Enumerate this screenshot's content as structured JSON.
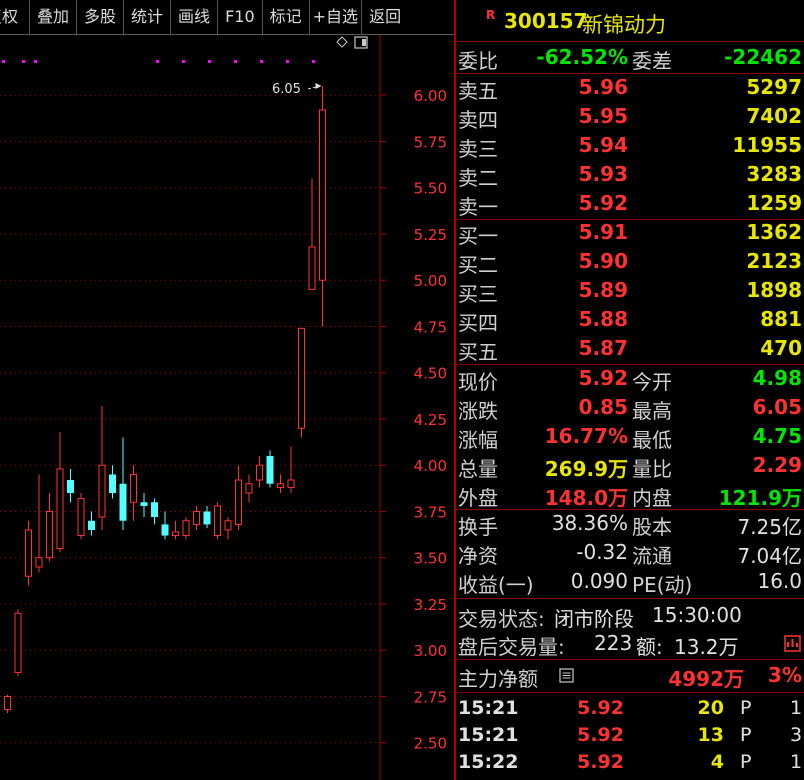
{
  "toolbar": [
    "复权",
    "叠加",
    "多股",
    "统计",
    "画线",
    "F10",
    "标记",
    "+自选",
    "返回"
  ],
  "chart_data": {
    "type": "candlestick",
    "ylim": [
      2.45,
      6.12
    ],
    "y_ticks": [
      "6.00",
      "5.75",
      "5.50",
      "5.25",
      "5.00",
      "4.75",
      "4.50",
      "4.25",
      "4.00",
      "3.75",
      "3.50",
      "3.25",
      "3.00",
      "2.75",
      "2.50"
    ],
    "high_annotation": "6.05",
    "candles": [
      {
        "o": 2.68,
        "c": 2.75,
        "h": 2.76,
        "l": 2.66
      },
      {
        "o": 2.88,
        "c": 3.2,
        "h": 3.22,
        "l": 2.86
      },
      {
        "o": 3.4,
        "c": 3.65,
        "h": 3.7,
        "l": 3.35
      },
      {
        "o": 3.45,
        "c": 3.5,
        "h": 3.95,
        "l": 3.42
      },
      {
        "o": 3.5,
        "c": 3.75,
        "h": 3.85,
        "l": 3.48
      },
      {
        "o": 3.55,
        "c": 3.98,
        "h": 4.18,
        "l": 3.53
      },
      {
        "o": 3.92,
        "c": 3.85,
        "h": 3.98,
        "l": 3.8
      },
      {
        "o": 3.62,
        "c": 3.82,
        "h": 3.85,
        "l": 3.6
      },
      {
        "o": 3.7,
        "c": 3.65,
        "h": 3.75,
        "l": 3.62
      },
      {
        "o": 3.72,
        "c": 4.0,
        "h": 4.32,
        "l": 3.65
      },
      {
        "o": 3.95,
        "c": 3.85,
        "h": 4.0,
        "l": 3.82
      },
      {
        "o": 3.9,
        "c": 3.7,
        "h": 4.15,
        "l": 3.65
      },
      {
        "o": 3.8,
        "c": 3.95,
        "h": 4.0,
        "l": 3.7
      },
      {
        "o": 3.8,
        "c": 3.78,
        "h": 3.85,
        "l": 3.72
      },
      {
        "o": 3.8,
        "c": 3.72,
        "h": 3.82,
        "l": 3.68
      },
      {
        "o": 3.68,
        "c": 3.62,
        "h": 3.75,
        "l": 3.6
      },
      {
        "o": 3.62,
        "c": 3.64,
        "h": 3.7,
        "l": 3.6
      },
      {
        "o": 3.62,
        "c": 3.7,
        "h": 3.72,
        "l": 3.6
      },
      {
        "o": 3.68,
        "c": 3.75,
        "h": 3.78,
        "l": 3.65
      },
      {
        "o": 3.75,
        "c": 3.68,
        "h": 3.78,
        "l": 3.66
      },
      {
        "o": 3.62,
        "c": 3.78,
        "h": 3.8,
        "l": 3.6
      },
      {
        "o": 3.65,
        "c": 3.7,
        "h": 3.72,
        "l": 3.6
      },
      {
        "o": 3.68,
        "c": 3.92,
        "h": 4.0,
        "l": 3.65
      },
      {
        "o": 3.85,
        "c": 3.9,
        "h": 3.95,
        "l": 3.8
      },
      {
        "o": 3.92,
        "c": 4.0,
        "h": 4.05,
        "l": 3.88
      },
      {
        "o": 4.05,
        "c": 3.9,
        "h": 4.08,
        "l": 3.88
      },
      {
        "o": 3.88,
        "c": 3.9,
        "h": 3.95,
        "l": 3.85
      },
      {
        "o": 3.88,
        "c": 3.92,
        "h": 4.1,
        "l": 3.85
      },
      {
        "o": 4.2,
        "c": 4.74,
        "h": 4.74,
        "l": 4.15
      },
      {
        "o": 4.95,
        "c": 5.18,
        "h": 5.55,
        "l": 4.95
      },
      {
        "o": 5.0,
        "c": 5.92,
        "h": 6.05,
        "l": 4.75
      }
    ]
  },
  "quote": {
    "flag": "R",
    "code": "300157",
    "name": "新锦动力",
    "wb_label": "委比",
    "wb": "-62.52%",
    "wc_label": "委差",
    "wc": "-22462",
    "asks": [
      {
        "label": "卖五",
        "price": "5.96",
        "vol": "5297"
      },
      {
        "label": "卖四",
        "price": "5.95",
        "vol": "7402"
      },
      {
        "label": "卖三",
        "price": "5.94",
        "vol": "11955"
      },
      {
        "label": "卖二",
        "price": "5.93",
        "vol": "3283"
      },
      {
        "label": "卖一",
        "price": "5.92",
        "vol": "1259"
      }
    ],
    "bids": [
      {
        "label": "买一",
        "price": "5.91",
        "vol": "1362"
      },
      {
        "label": "买二",
        "price": "5.90",
        "vol": "2123"
      },
      {
        "label": "买三",
        "price": "5.89",
        "vol": "1898"
      },
      {
        "label": "买四",
        "price": "5.88",
        "vol": "881"
      },
      {
        "label": "买五",
        "price": "5.87",
        "vol": "470"
      }
    ],
    "stats": [
      {
        "l1": "现价",
        "v1": "5.92",
        "c1": "red",
        "l2": "今开",
        "v2": "4.98",
        "c2": "grn"
      },
      {
        "l1": "涨跌",
        "v1": "0.85",
        "c1": "red",
        "l2": "最高",
        "v2": "6.05",
        "c2": "red"
      },
      {
        "l1": "涨幅",
        "v1": "16.77%",
        "c1": "red",
        "l2": "最低",
        "v2": "4.75",
        "c2": "grn"
      },
      {
        "l1": "总量",
        "v1": "269.9万",
        "c1": "yel",
        "l2": "量比",
        "v2": "2.29",
        "c2": "red"
      },
      {
        "l1": "外盘",
        "v1": "148.0万",
        "c1": "red",
        "l2": "内盘",
        "v2": "121.9万",
        "c2": "grn"
      }
    ],
    "fin": [
      {
        "l1": "换手",
        "v1": "38.36%",
        "l2": "股本",
        "v2": "7.25亿"
      },
      {
        "l1": "净资",
        "v1": "-0.32",
        "l2": "流通",
        "v2": "7.04亿"
      },
      {
        "l1": "收益(一)",
        "v1": "0.090",
        "l2": "PE(动)",
        "v2": "16.0"
      }
    ],
    "status_label": "交易状态:",
    "status": "闭市阶段",
    "status_time": "15:30:00",
    "after_label": "盘后交易量:",
    "after_vol": "223",
    "after_amt_label": "额:",
    "after_amt": "13.2万",
    "main_label": "主力净额",
    "main_val": "4992万",
    "main_pct": "3%"
  },
  "ticks": [
    {
      "time": "15:21",
      "price": "5.92",
      "vol": "20",
      "flag": "P",
      "n": "1"
    },
    {
      "time": "15:21",
      "price": "5.92",
      "vol": "13",
      "flag": "P",
      "n": "3"
    },
    {
      "time": "15:22",
      "price": "5.92",
      "vol": "4",
      "flag": "P",
      "n": "1"
    }
  ],
  "colors": {
    "up": "#ff3232",
    "down": "#54ffff",
    "grid": "#a00000",
    "accent": "#e6e600",
    "marker": "#ff00ff"
  }
}
